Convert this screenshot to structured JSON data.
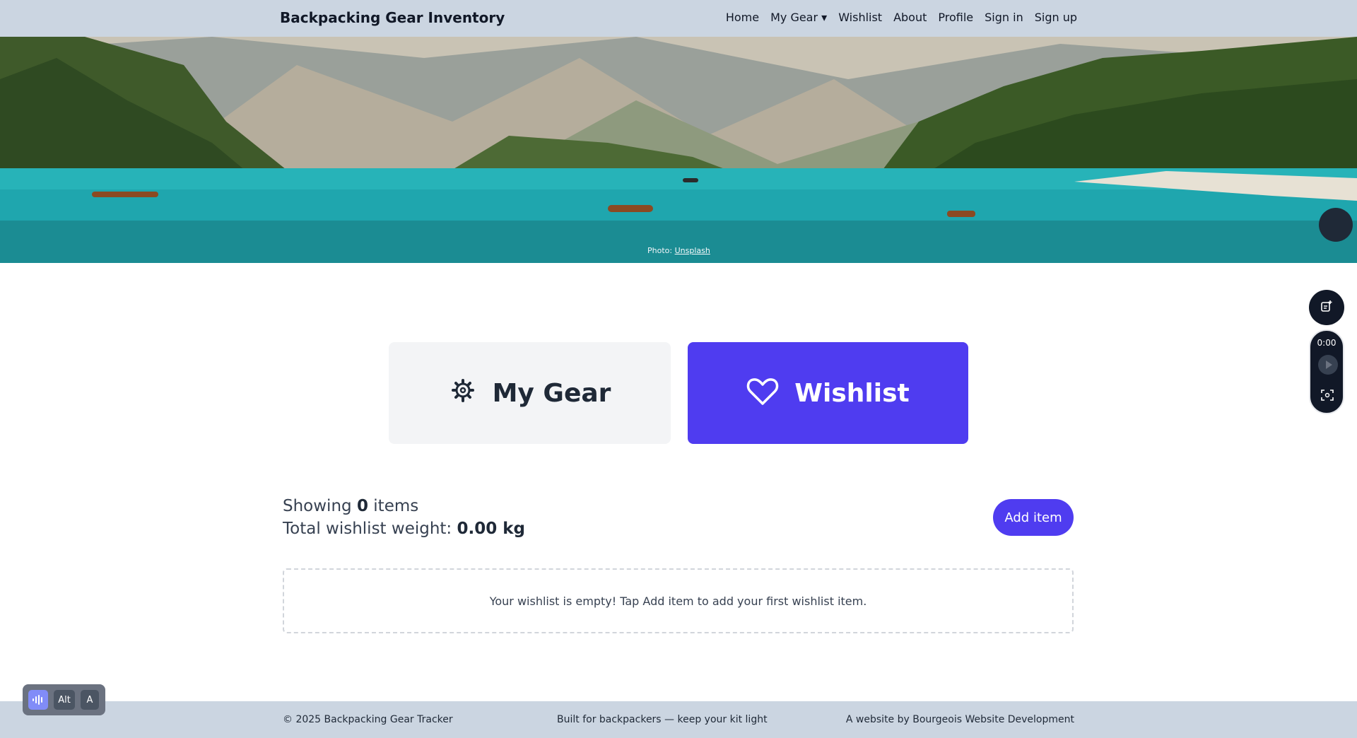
{
  "header": {
    "brand": "Backpacking Gear Inventory",
    "nav": [
      "Home",
      "My Gear ▾",
      "Wishlist",
      "About",
      "Profile",
      "Sign in",
      "Sign up"
    ]
  },
  "hero": {
    "credit_prefix": "Photo:",
    "credit_link": "Unsplash"
  },
  "cards": {
    "gear": {
      "title": "My Gear",
      "icon": "gear-icon"
    },
    "wishlist": {
      "title": "Wishlist",
      "icon": "heart-icon"
    }
  },
  "summary": {
    "showing_prefix": "Showing",
    "count": "0",
    "showing_suffix": "items",
    "weight_prefix": "Total wishlist weight:",
    "weight": "0.00 kg",
    "add_label": "Add item"
  },
  "empty_message": "Your wishlist is empty! Tap Add item to add your first wishlist item.",
  "footer": {
    "left": "© 2025 Backpacking Gear Tracker",
    "center": "Built for backpackers — keep your kit light",
    "right": "A website by Bourgeois Website Development"
  },
  "widgets": {
    "player_time": "0:00",
    "a11y_keys": [
      "Alt",
      "A"
    ]
  },
  "colors": {
    "accent": "#4f3cf0",
    "bar": "#cbd5e1"
  }
}
